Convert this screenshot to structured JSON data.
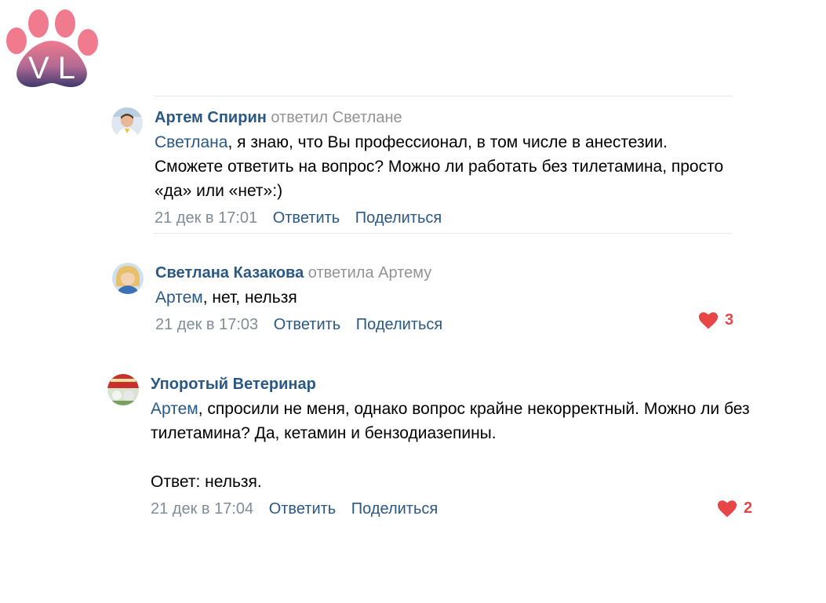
{
  "colors": {
    "link": "#2a5885",
    "muted": "#939393",
    "meta": "#818c99",
    "like": "#e64646"
  },
  "logo": {
    "icon": "paw-vl-logo",
    "text": "VL"
  },
  "comments": [
    {
      "author": "Артем Спирин",
      "reply_note": "ответил Светлане",
      "mention": "Светлана",
      "text": ", я знаю, что Вы профессионал, в том числе в анестезии. Сможете ответить на вопрос? Можно ли работать без тилетамина, просто «да» или «нет»:)",
      "date": "21 дек в 17:01",
      "reply_label": "Ответить",
      "share_label": "Поделиться"
    },
    {
      "author": "Светлана Казакова",
      "reply_note": "ответила Артему",
      "mention": "Артем",
      "text": ", нет, нельзя",
      "date": "21 дек в 17:03",
      "reply_label": "Ответить",
      "share_label": "Поделиться",
      "likes": "3"
    },
    {
      "author": "Упоротый Ветеринар",
      "mention": "Артем",
      "text": ", спросили не меня, однако вопрос крайне некорректный. Можно ли без тилетамина? Да, кетамин и бензодиазепины.",
      "text2": "Ответ: нельзя.",
      "date": "21 дек в 17:04",
      "reply_label": "Ответить",
      "share_label": "Поделиться",
      "likes": "2"
    }
  ]
}
